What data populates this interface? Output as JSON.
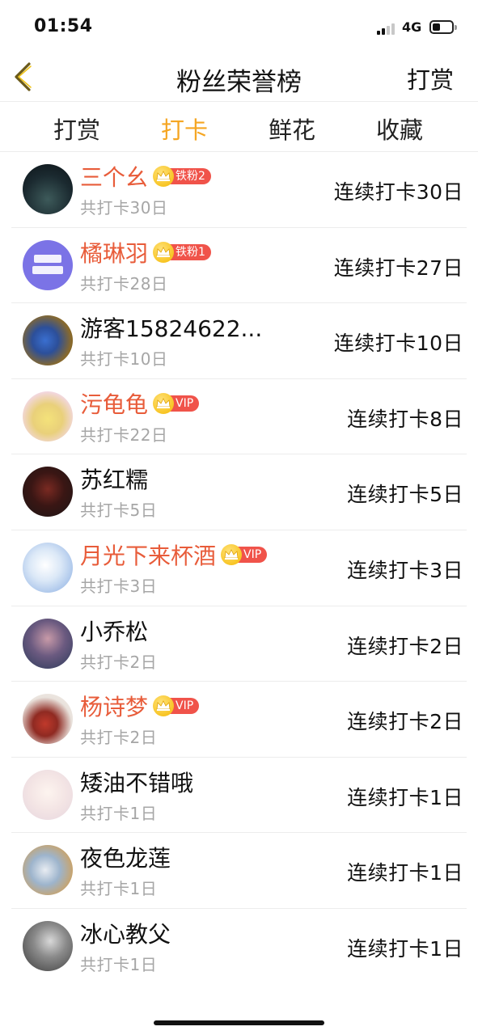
{
  "status_bar": {
    "time": "01:54",
    "network": "4G"
  },
  "nav": {
    "title": "粉丝荣誉榜",
    "right_action": "打赏"
  },
  "tabs": [
    {
      "label": "打赏",
      "active": false
    },
    {
      "label": "打卡",
      "active": true
    },
    {
      "label": "鲜花",
      "active": false
    },
    {
      "label": "收藏",
      "active": false
    }
  ],
  "colors": {
    "accent": "#f5a623",
    "vip_name": "#e85c3a",
    "badge": "#f0534a",
    "muted": "#a6a6a6"
  },
  "users": [
    {
      "name": "三个幺",
      "vip": true,
      "badge": "铁粉2",
      "total": "共打卡30日",
      "streak": "连续打卡30日",
      "avatar": "dark-landscape"
    },
    {
      "name": "橘琳羽",
      "vip": true,
      "badge": "铁粉1",
      "total": "共打卡28日",
      "streak": "连续打卡27日",
      "avatar": "purple-text-logo"
    },
    {
      "name": "游客15824622...",
      "vip": false,
      "badge": "",
      "total": "共打卡10日",
      "streak": "连续打卡10日",
      "avatar": "blue-bird"
    },
    {
      "name": "污龟龟",
      "vip": true,
      "badge": "VIP",
      "total": "共打卡22日",
      "streak": "连续打卡8日",
      "avatar": "cartoon-sponge"
    },
    {
      "name": "苏红糯",
      "vip": false,
      "badge": "",
      "total": "共打卡5日",
      "streak": "连续打卡5日",
      "avatar": "dark-red-figure"
    },
    {
      "name": "月光下来杯酒",
      "vip": true,
      "badge": "VIP",
      "total": "共打卡3日",
      "streak": "连续打卡3日",
      "avatar": "anime-girl"
    },
    {
      "name": "小乔松",
      "vip": false,
      "badge": "",
      "total": "共打卡2日",
      "streak": "连续打卡2日",
      "avatar": "night-tree"
    },
    {
      "name": "杨诗梦",
      "vip": true,
      "badge": "VIP",
      "total": "共打卡2日",
      "streak": "连续打卡2日",
      "avatar": "red-dress-figure"
    },
    {
      "name": "矮油不错哦",
      "vip": false,
      "badge": "",
      "total": "共打卡1日",
      "streak": "连续打卡1日",
      "avatar": "pale-portrait"
    },
    {
      "name": "夜色龙莲",
      "vip": false,
      "badge": "",
      "total": "共打卡1日",
      "streak": "连续打卡1日",
      "avatar": "lotus-art"
    },
    {
      "name": "冰心教父",
      "vip": false,
      "badge": "",
      "total": "共打卡1日",
      "streak": "连续打卡1日",
      "avatar": "grey-figure"
    }
  ]
}
